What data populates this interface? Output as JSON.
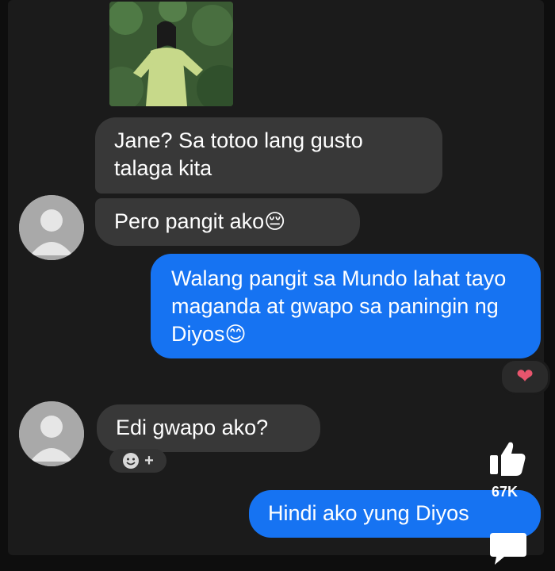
{
  "messages": [
    {
      "from": "other",
      "text": "Jane? Sa totoo lang gusto talaga kita"
    },
    {
      "from": "other",
      "text": "Pero pangit ako",
      "emoji": "😔"
    },
    {
      "from": "me",
      "text": "Walang pangit sa Mundo lahat tayo maganda at gwapo sa paningin ng Diyos",
      "emoji": "😊"
    },
    {
      "from": "other",
      "text": "Edi gwapo ako?"
    },
    {
      "from": "me",
      "text": "Hindi ako yung Diyos"
    }
  ],
  "reactions": {
    "heart": "❤",
    "add_plus": "+"
  },
  "overlay": {
    "like_count": "67K"
  },
  "colors": {
    "sent_bubble": "#1673f2",
    "received_bubble": "#383838",
    "background": "#1b1b1b",
    "heart": "#e8556d"
  },
  "icons": [
    "avatar-placeholder-icon",
    "heart-icon",
    "smiley-icon",
    "thumbs-up-icon",
    "comment-icon"
  ]
}
